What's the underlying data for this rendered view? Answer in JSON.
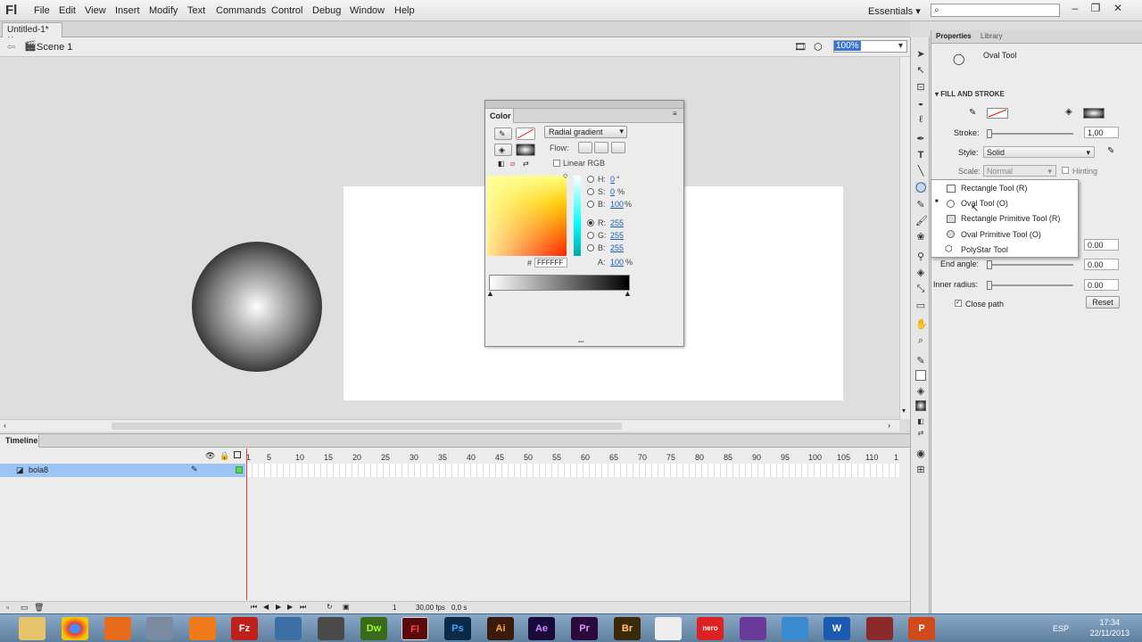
{
  "app": {
    "logo": "Fl",
    "menu": [
      "File",
      "Edit",
      "View",
      "Insert",
      "Modify",
      "Text",
      "Commands",
      "Control",
      "Debug",
      "Window",
      "Help"
    ],
    "workspace": "Essentials"
  },
  "document": {
    "tab": "Untitled-1*",
    "scene": "Scene 1",
    "zoom": "100%"
  },
  "color_panel": {
    "title": "Color",
    "type": "Radial gradient",
    "flow_label": "Flow:",
    "linear_rgb": "Linear RGB",
    "H_label": "H:",
    "H": "0",
    "H_unit": "°",
    "S_label": "S:",
    "S": "0",
    "S_unit": "%",
    "B_label": "B:",
    "B": "100",
    "B_unit": "%",
    "R_label": "R:",
    "R": "255",
    "G_label": "G:",
    "G": "255",
    "Bb_label": "B:",
    "Bb": "255",
    "A_label": "A:",
    "A": "100",
    "A_unit": "%",
    "hex_prefix": "#",
    "hex": "FFFFFF"
  },
  "properties": {
    "tabs": [
      "Properties",
      "Library"
    ],
    "tool_name": "Oval Tool",
    "section": "FILL AND STROKE",
    "stroke_label": "Stroke:",
    "stroke_value": "1,00",
    "style_label": "Style:",
    "style_value": "Solid",
    "scale_label": "Scale:",
    "scale_value": "Normal",
    "hinting": "Hinting",
    "start_angle_value": "0.00",
    "end_angle_label": "End angle:",
    "end_angle_value": "0.00",
    "inner_radius_label": "Inner radius:",
    "inner_radius_value": "0.00",
    "close_path": "Close path",
    "reset": "Reset"
  },
  "tool_dropdown": [
    "Rectangle Tool (R)",
    "Oval Tool (O)",
    "Rectangle Primitive Tool (R)",
    "Oval Primitive Tool (O)",
    "PolyStar Tool"
  ],
  "timeline": {
    "title": "Timeline",
    "layer": "bola8",
    "frame_numbers": [
      "1",
      "5",
      "10",
      "15",
      "20",
      "25",
      "30",
      "35",
      "40",
      "45",
      "50",
      "55",
      "60",
      "65",
      "70",
      "75",
      "80",
      "85",
      "90",
      "95",
      "100",
      "105",
      "110",
      "1"
    ],
    "current_frame": "1",
    "fps": "30,00 fps",
    "time": "0,0 s"
  },
  "taskbar": {
    "apps": [
      "",
      "",
      "",
      "",
      "",
      "Fz",
      "",
      "",
      "Dw",
      "Fl",
      "Ps",
      "Ai",
      "Ae",
      "Pr",
      "Br",
      "",
      "nero",
      "",
      "",
      "W",
      "",
      "P"
    ],
    "lang": "ESP",
    "time": "17:34",
    "date": "22/11/2013"
  }
}
